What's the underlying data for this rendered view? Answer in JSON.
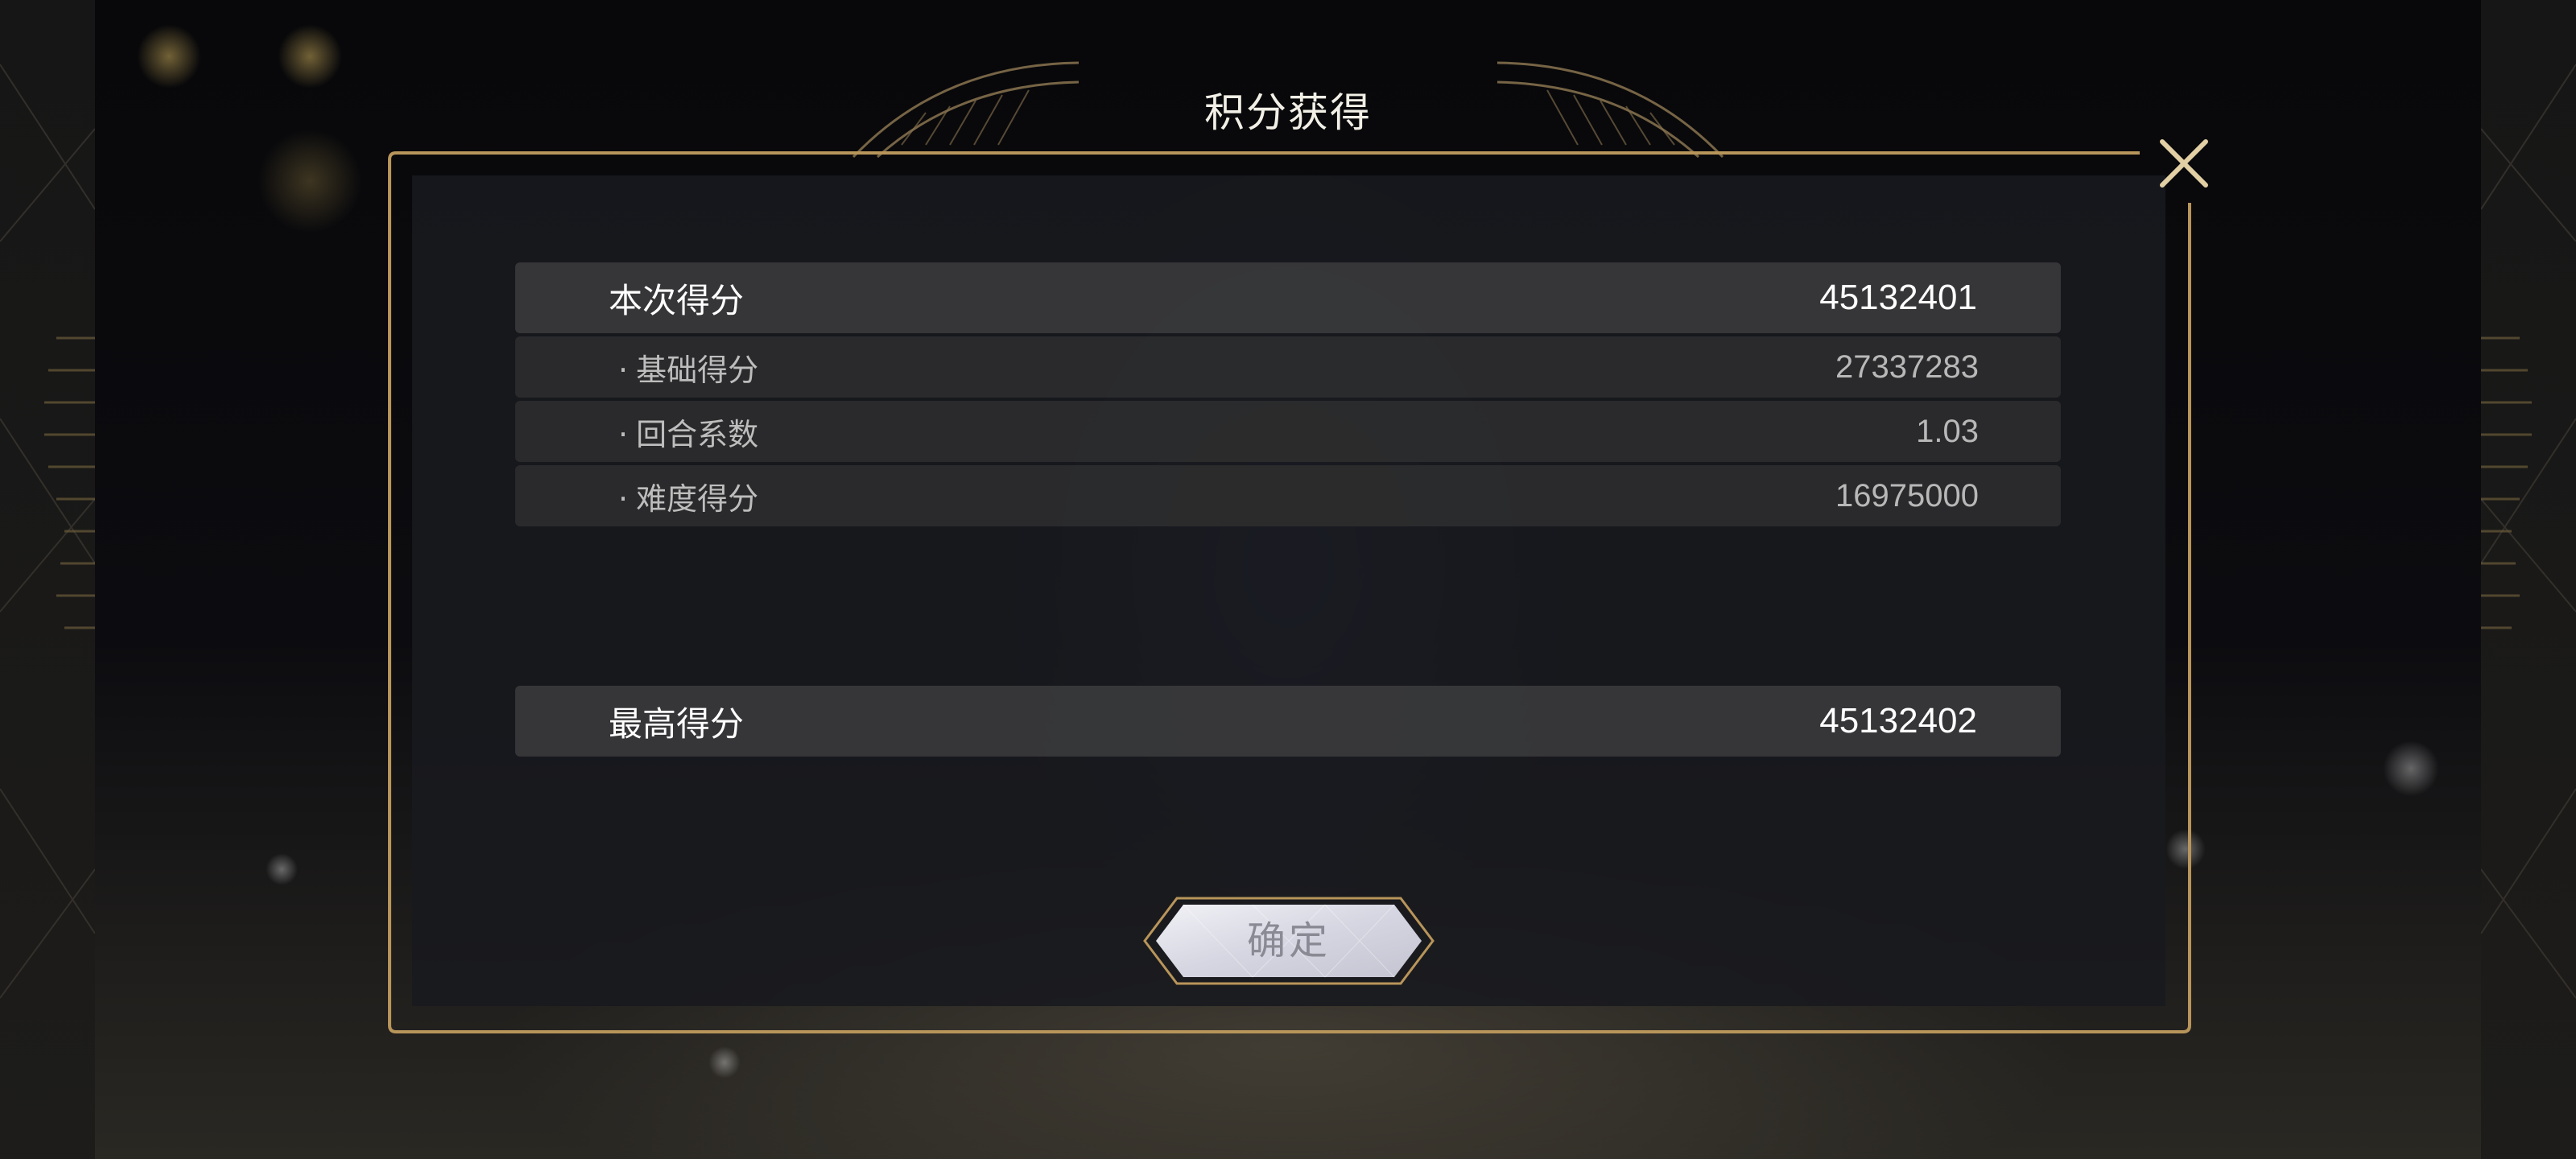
{
  "dialog": {
    "title": "积分获得",
    "current_score": {
      "label": "本次得分",
      "value": "45132401"
    },
    "breakdown": [
      {
        "bullet": "·",
        "label": "基础得分",
        "value": "27337283"
      },
      {
        "bullet": "·",
        "label": "回合系数",
        "value": "1.03"
      },
      {
        "bullet": "·",
        "label": "难度得分",
        "value": "16975000"
      }
    ],
    "best_score": {
      "label": "最高得分",
      "value": "45132402"
    },
    "confirm_label": "确定"
  },
  "icons": {
    "close": "close-icon"
  },
  "colors": {
    "frame_gold": "#b8955a",
    "panel_bg": "#18191e",
    "row_main_bg": "#3a3a3c",
    "row_sub_bg": "#2c2c2e",
    "text_primary": "#ffffff",
    "text_secondary": "#bdbdbd",
    "button_fill": "#dcdce6"
  }
}
